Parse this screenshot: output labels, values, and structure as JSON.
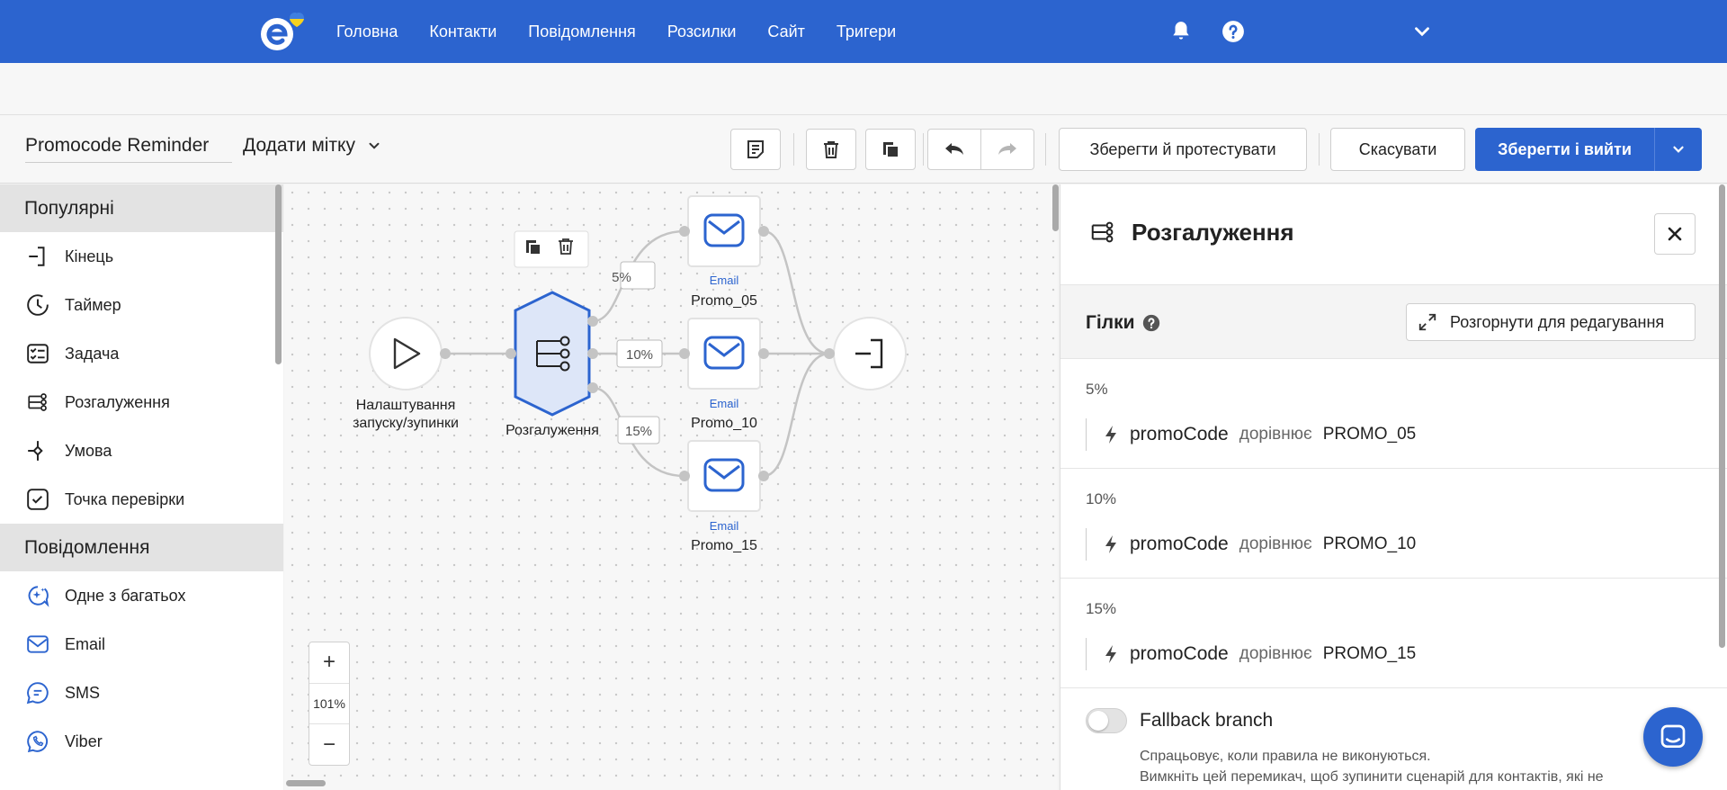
{
  "nav": {
    "items": [
      "Головна",
      "Контакти",
      "Повідомлення",
      "Розсилки",
      "Сайт",
      "Тригери"
    ],
    "colors": {
      "brand": "#2c64cf",
      "flag_blue": "#3f7fe0",
      "flag_yellow": "#f7d21e"
    }
  },
  "toolbar": {
    "scenario_name": "Promocode Reminder",
    "tag_label": "Додати мітку",
    "save_test_label": "Зберегти й протестувати",
    "cancel_label": "Скасувати",
    "save_exit_label": "Зберегти і вийти"
  },
  "sidebar": {
    "sections": [
      {
        "title": "Популярні",
        "items": [
          {
            "label": "Кінець",
            "icon": "end-icon"
          },
          {
            "label": "Таймер",
            "icon": "timer-icon"
          },
          {
            "label": "Задача",
            "icon": "task-icon"
          },
          {
            "label": "Розгалуження",
            "icon": "branch-icon"
          },
          {
            "label": "Умова",
            "icon": "condition-icon"
          },
          {
            "label": "Точка перевірки",
            "icon": "checkpoint-icon"
          }
        ]
      },
      {
        "title": "Повідомлення",
        "items": [
          {
            "label": "Одне з багатьох",
            "icon": "one-of-many-icon"
          },
          {
            "label": "Email",
            "icon": "email-icon"
          },
          {
            "label": "SMS",
            "icon": "sms-icon"
          },
          {
            "label": "Viber",
            "icon": "viber-icon"
          }
        ]
      }
    ]
  },
  "canvas": {
    "start_label_1": "Налаштування",
    "start_label_2": "запуску/зупинки",
    "split_label": "Розгалуження",
    "branches": [
      {
        "percent": "5%",
        "type": "Email",
        "name": "Promo_05"
      },
      {
        "percent": "10%",
        "type": "Email",
        "name": "Promo_10"
      },
      {
        "percent": "15%",
        "type": "Email",
        "name": "Promo_15"
      }
    ],
    "zoom": "101%"
  },
  "panel": {
    "title": "Розгалуження",
    "branches_title": "Гілки",
    "expand_label": "Розгорнути для редагування",
    "branches": [
      {
        "percent": "5%",
        "field": "promoCode",
        "operator": "дорівнює",
        "value": "PROMO_05"
      },
      {
        "percent": "10%",
        "field": "promoCode",
        "operator": "дорівнює",
        "value": "PROMO_10"
      },
      {
        "percent": "15%",
        "field": "promoCode",
        "operator": "дорівнює",
        "value": "PROMO_15"
      }
    ],
    "fallback_label": "Fallback branch",
    "fallback_on": false,
    "fallback_desc_1": "Спрацьовує, коли правила не виконуються.",
    "fallback_desc_2": "Вимкніть цей перемикач, щоб зупинити сценарій для контактів, які не"
  }
}
